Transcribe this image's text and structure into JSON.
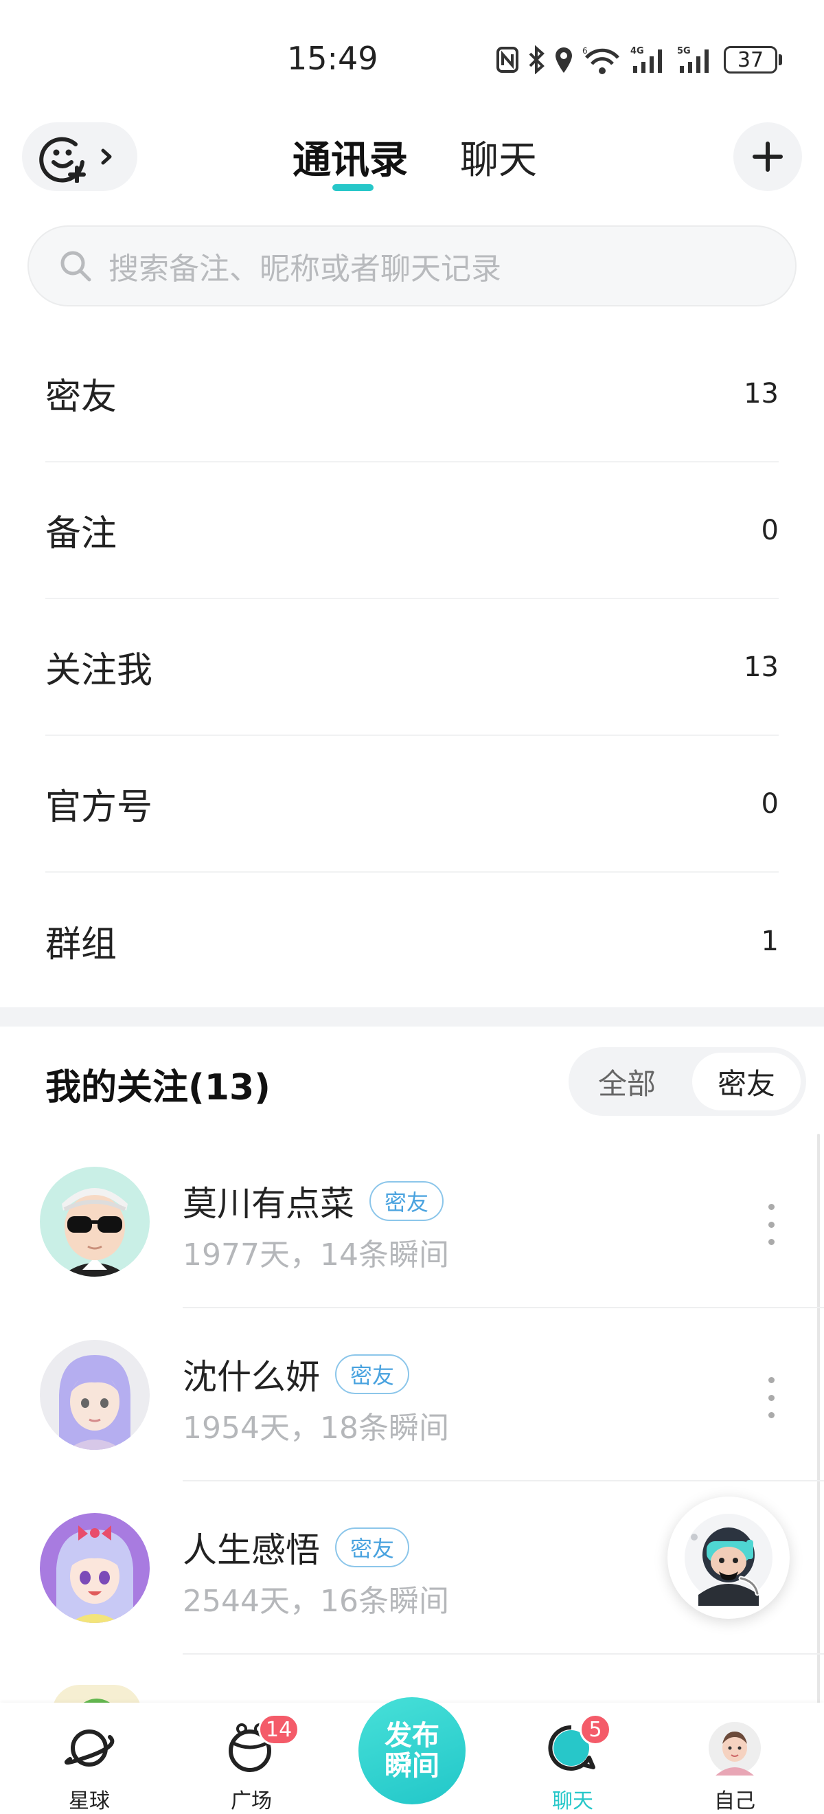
{
  "status_bar": {
    "time": "15:49",
    "battery": "37"
  },
  "header": {
    "tabs": [
      {
        "label": "通讯录",
        "active": true
      },
      {
        "label": "聊天",
        "active": false
      }
    ],
    "accent_color": "#27c7c9"
  },
  "search": {
    "placeholder": "搜索备注、昵称或者聊天记录"
  },
  "categories": [
    {
      "label": "密友",
      "count": "13"
    },
    {
      "label": "备注",
      "count": "0"
    },
    {
      "label": "关注我",
      "count": "13"
    },
    {
      "label": "官方号",
      "count": "0"
    },
    {
      "label": "群组",
      "count": "1"
    }
  ],
  "following": {
    "title": "我的关注(13)",
    "filters": [
      {
        "label": "全部",
        "selected": false
      },
      {
        "label": "密友",
        "selected": true
      }
    ],
    "items": [
      {
        "name": "莫川有点菜",
        "badge": "密友",
        "sub": "1977天，14条瞬间"
      },
      {
        "name": "沈什么妍",
        "badge": "密友",
        "sub": "1954天，18条瞬间"
      },
      {
        "name": "人生感悟",
        "badge": "密友",
        "sub": "2544天，16条瞬间"
      }
    ]
  },
  "bottom_nav": {
    "items": [
      {
        "label": "星球",
        "icon": "planet-icon",
        "active": false
      },
      {
        "label": "广场",
        "icon": "square-icon",
        "badge": "14",
        "active": false
      },
      {
        "label": "聊天",
        "icon": "chat-icon",
        "badge": "5",
        "active": true
      },
      {
        "label": "自己",
        "icon": "profile-avatar-icon",
        "active": false
      }
    ],
    "publish_label_line1": "发布",
    "publish_label_line2": "瞬间"
  }
}
